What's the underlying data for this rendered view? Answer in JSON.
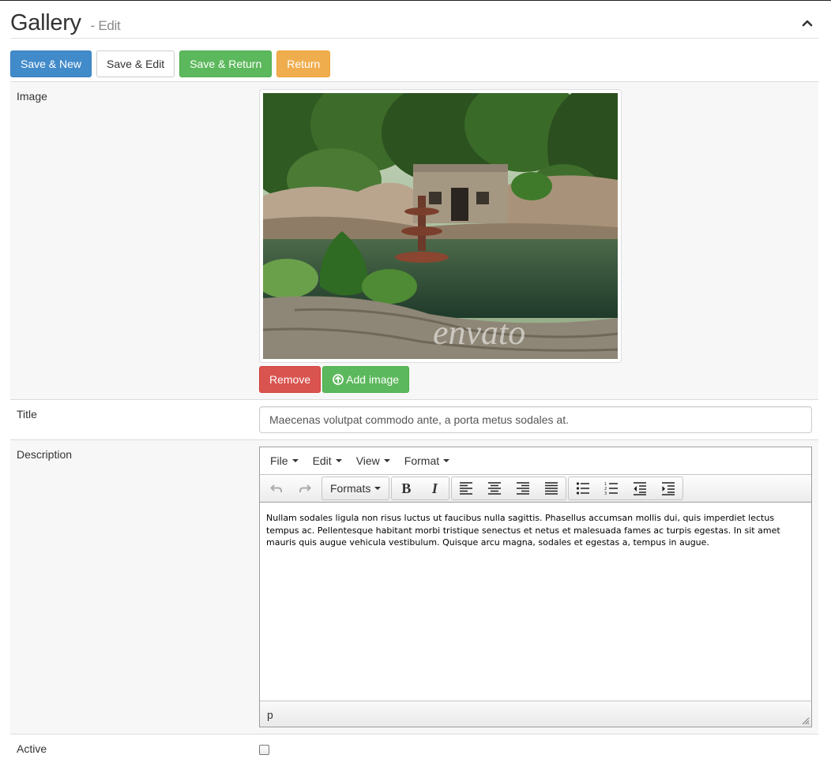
{
  "header": {
    "title": "Gallery",
    "subtitle": "- Edit",
    "collapse_icon": "chevron-up-icon"
  },
  "actions": {
    "save_new": "Save & New",
    "save_edit": "Save & Edit",
    "save_return": "Save & Return",
    "return": "Return"
  },
  "colors": {
    "primary": "#428bca",
    "success": "#5cb85c",
    "warning": "#f0ad4e",
    "danger": "#d9534f"
  },
  "form": {
    "image": {
      "label": "Image",
      "watermark": "envato",
      "remove_label": "Remove",
      "add_label": "Add image",
      "add_icon": "upload-circle-icon"
    },
    "title": {
      "label": "Title",
      "value": "Maecenas volutpat commodo ante, a porta metus sodales at."
    },
    "description": {
      "label": "Description",
      "menu": [
        "File",
        "Edit",
        "View",
        "Format"
      ],
      "formats_label": "Formats",
      "toolbar_icons": [
        "undo-icon",
        "redo-icon",
        "bold-icon",
        "italic-icon",
        "align-left-icon",
        "align-center-icon",
        "align-right-icon",
        "align-justify-icon",
        "bullet-list-icon",
        "numbered-list-icon",
        "outdent-icon",
        "indent-icon"
      ],
      "content": "Nullam sodales ligula non risus luctus ut faucibus nulla sagittis. Phasellus accumsan mollis dui, quis imperdiet lectus tempus ac. Pellentesque habitant morbi tristique senectus et netus et malesuada fames ac turpis egestas. In sit amet mauris quis augue vehicula vestibulum. Quisque arcu magna, sodales et egestas a, tempus in augue.",
      "status_path": "p",
      "bold_label": "B",
      "italic_label": "I"
    },
    "active": {
      "label": "Active",
      "checked": false
    }
  }
}
